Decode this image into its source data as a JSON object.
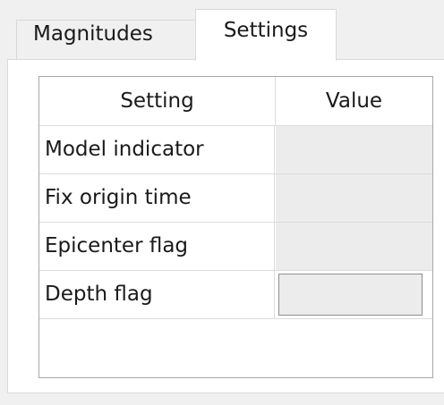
{
  "tabs": [
    {
      "label": "Magnitudes",
      "active": false
    },
    {
      "label": "Settings",
      "active": true
    }
  ],
  "table": {
    "columns": [
      "Setting",
      "Value"
    ],
    "rows": [
      {
        "label": "Model indicator",
        "value": ""
      },
      {
        "label": "Fix origin time",
        "value": ""
      },
      {
        "label": "Epicenter flag",
        "value": ""
      },
      {
        "label": "Depth flag",
        "value": ""
      }
    ]
  },
  "colors": {
    "window_background": "#f0f0f0",
    "pane_background": "#ffffff",
    "value_cell": "#ececec",
    "grid_line": "#dcdcdc"
  }
}
